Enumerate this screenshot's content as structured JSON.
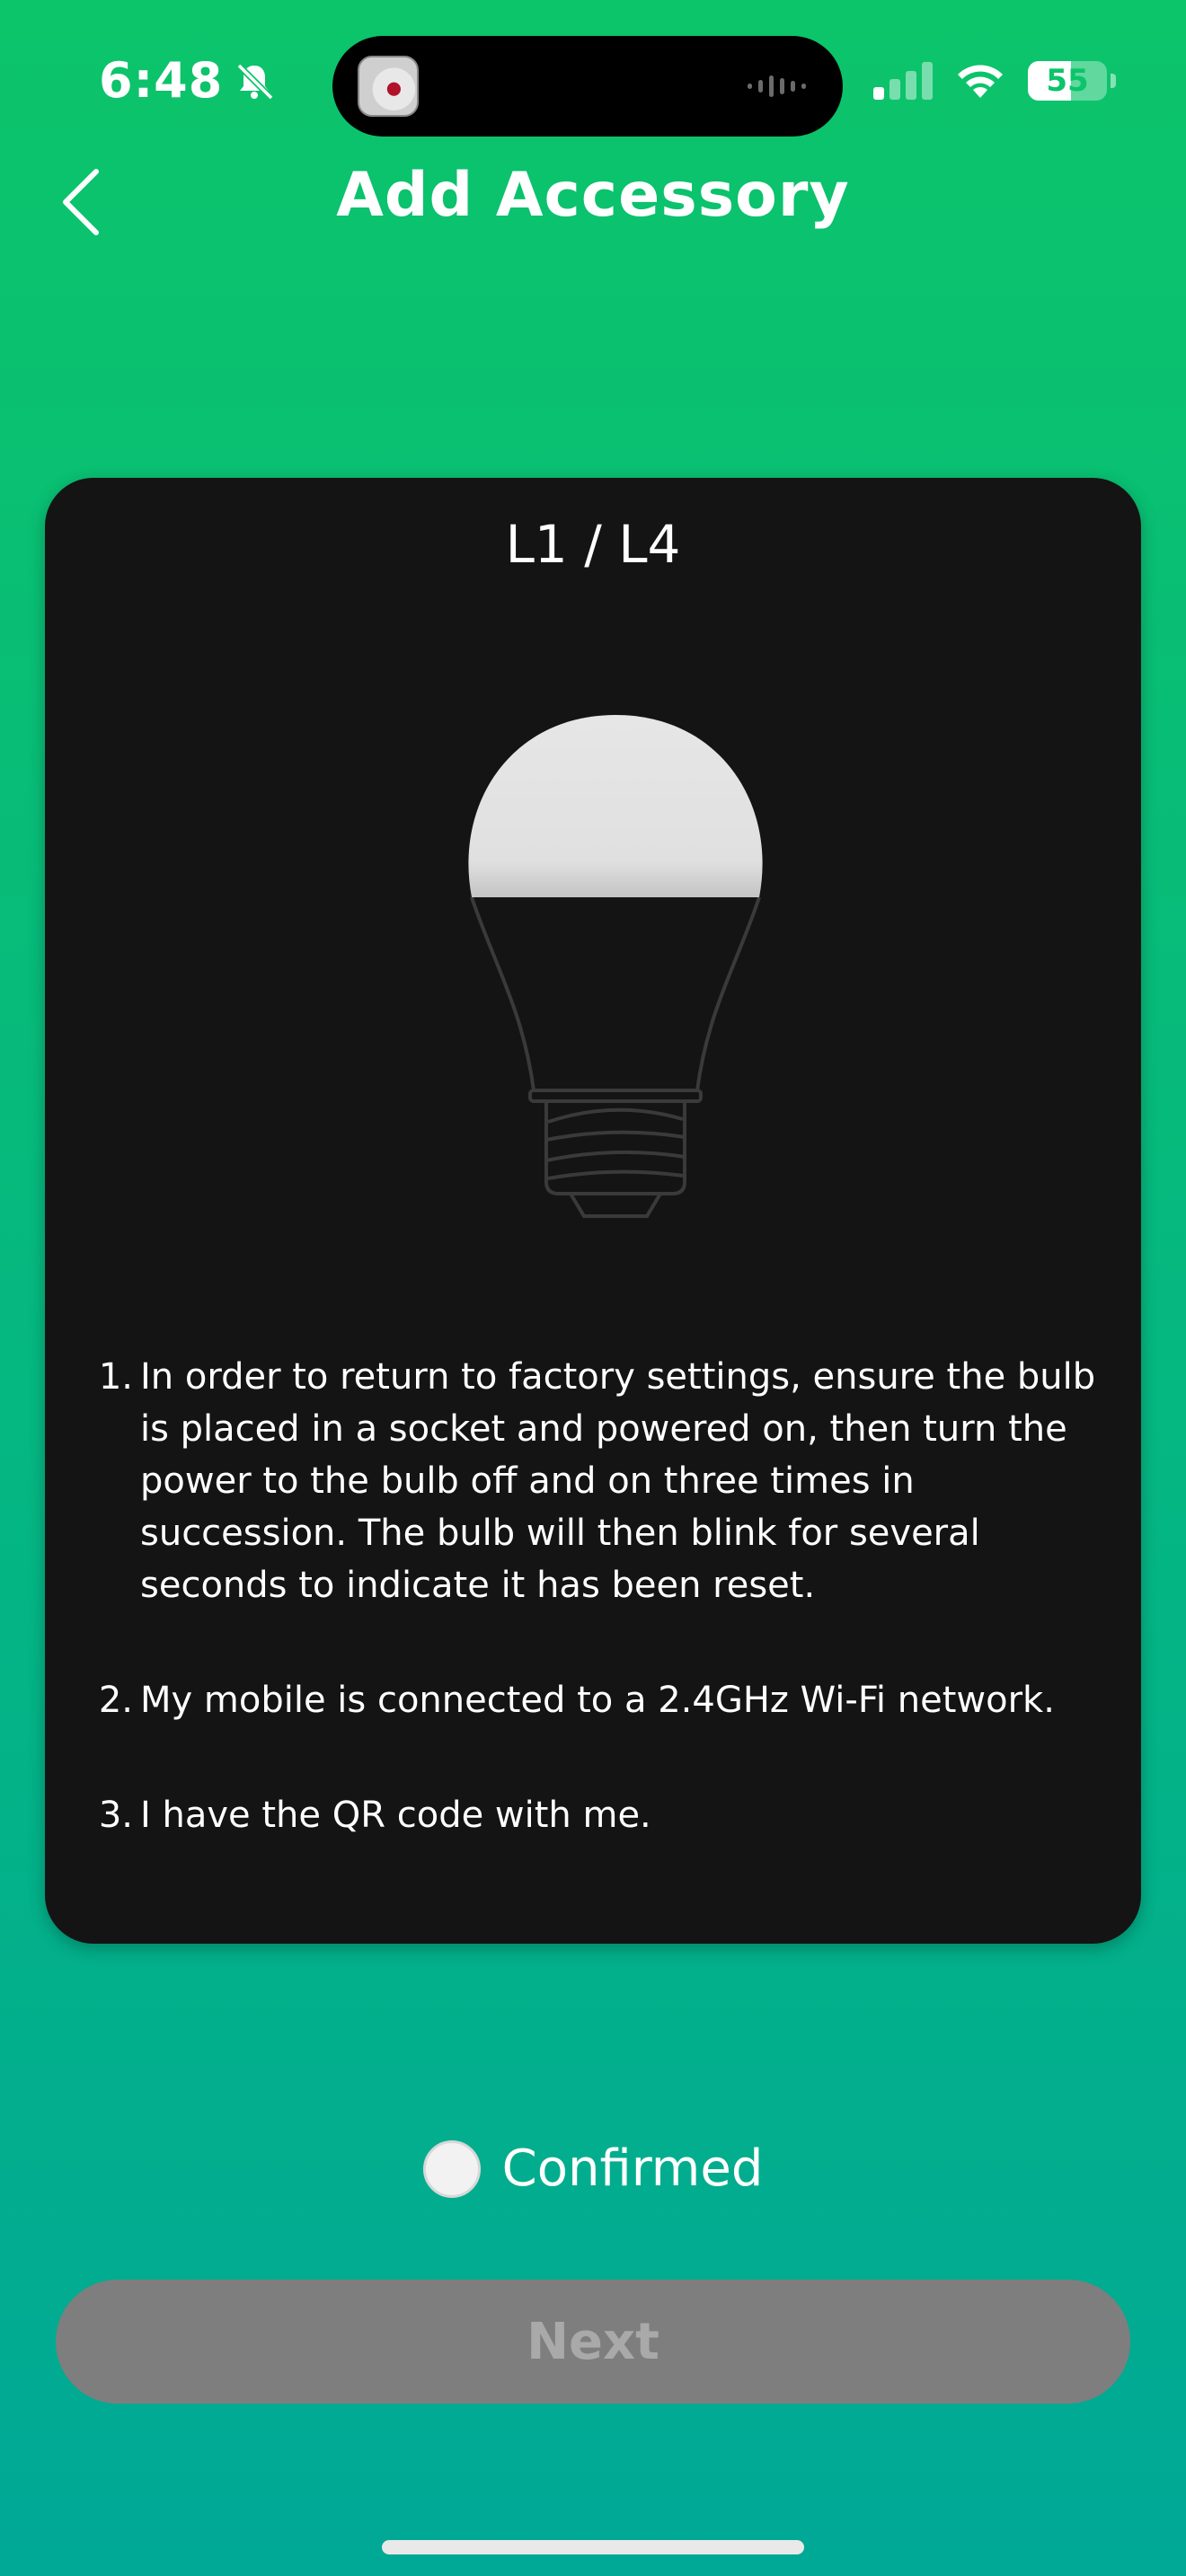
{
  "status_bar": {
    "time": "6:48",
    "battery": "55",
    "battery_level": 0.55,
    "icons": [
      "bell-slash-icon",
      "app-icon",
      "audio-wave-icon",
      "cellular-signal-icon",
      "wifi-icon",
      "battery-icon"
    ]
  },
  "header": {
    "title": "Add Accessory",
    "back_icon": "chevron-left-icon"
  },
  "card": {
    "title": "L1 / L4",
    "image": "light-bulb-icon",
    "steps": [
      {
        "number": "1.",
        "text": "In order to return to factory settings, ensure the bulb is placed in a socket and powered on, then turn the power to the bulb off and on three times in succession. The bulb will then blink for several seconds to indicate it has been reset."
      },
      {
        "number": "2.",
        "text": "My mobile is connected to a 2.4GHz Wi-Fi network."
      },
      {
        "number": "3.",
        "text": "I have the QR code with me."
      }
    ]
  },
  "confirm": {
    "label": "Confirmed",
    "checked": false
  },
  "next_button": {
    "label": "Next",
    "enabled": false
  },
  "colors": {
    "gradient_top": "#0cc46a",
    "gradient_bottom": "#00a896",
    "card_bg": "#141414",
    "button_disabled": "#7e7e7e"
  }
}
